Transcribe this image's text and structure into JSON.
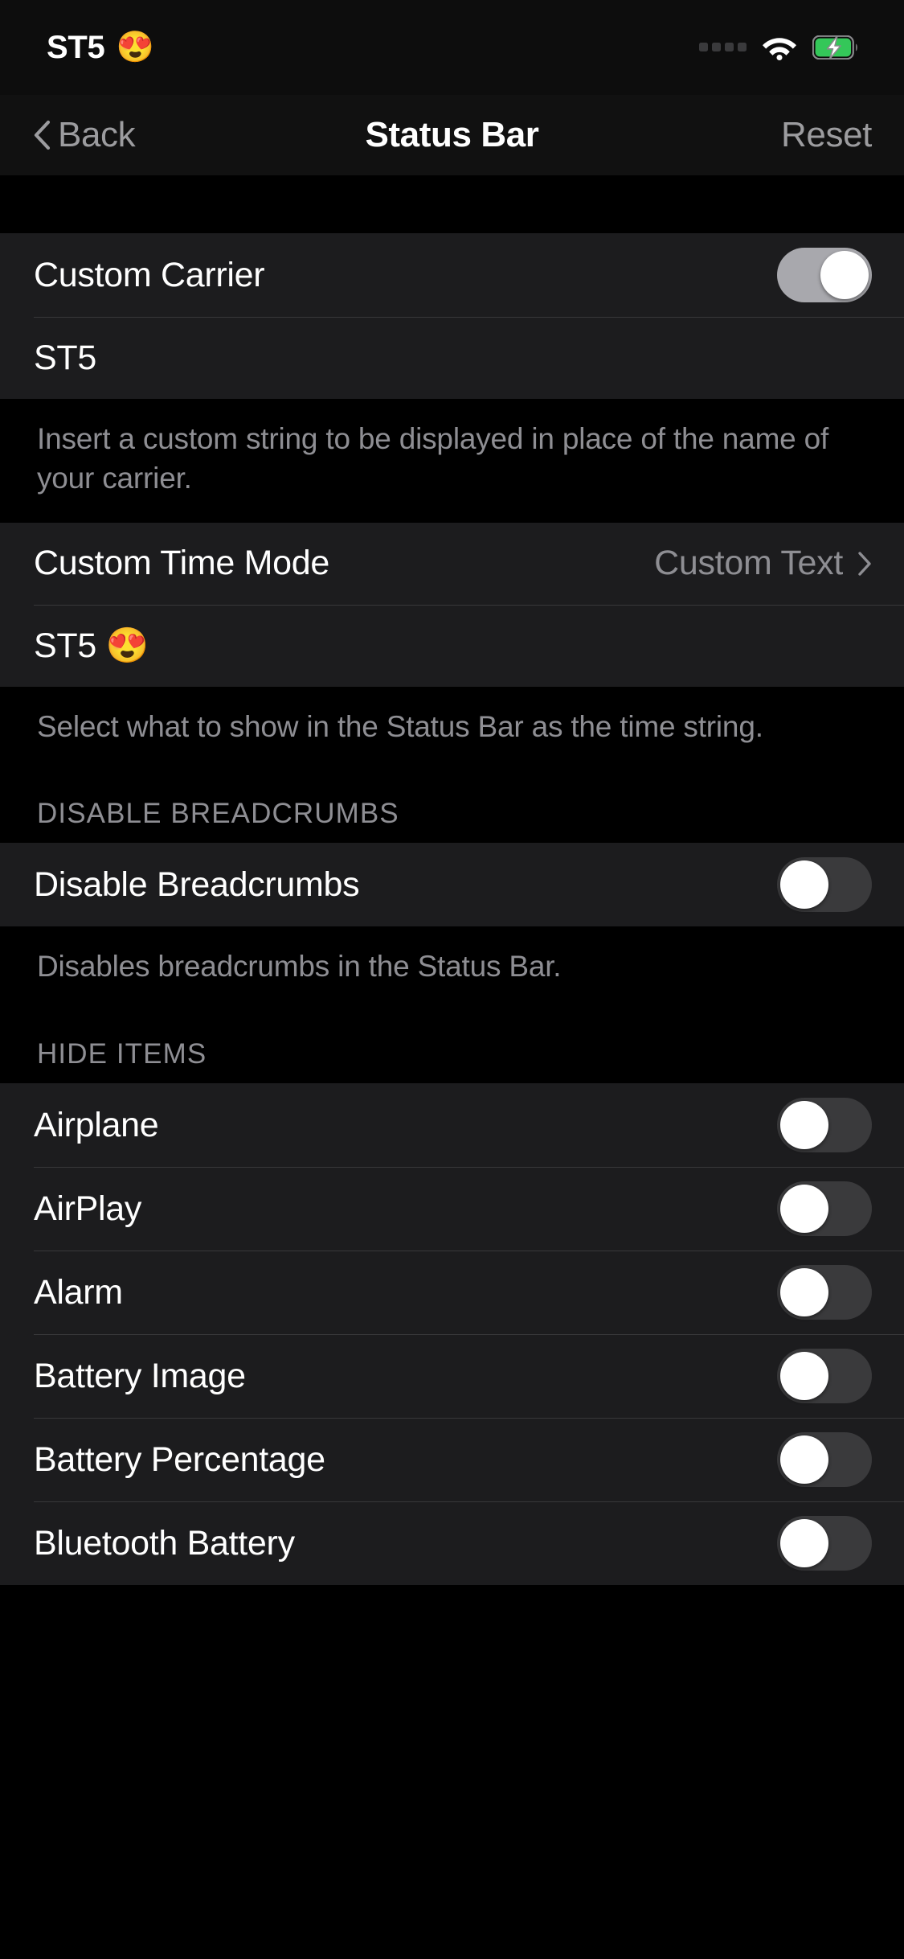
{
  "statusbar": {
    "carrier_text": "ST5",
    "carrier_emoji": "😍",
    "signal_icon": "signal-dots-icon",
    "wifi_icon": "wifi-icon",
    "battery_icon": "battery-charging-icon",
    "battery_color": "#34C759"
  },
  "navbar": {
    "back_label": "Back",
    "title": "Status Bar",
    "reset_label": "Reset"
  },
  "sections": {
    "carrier": {
      "toggle_label": "Custom Carrier",
      "toggle_state": "on",
      "field_value": "ST5",
      "field_placeholder": "ST5",
      "footer": "Insert a custom string to be displayed in place of the name of your carrier."
    },
    "time": {
      "mode_label": "Custom Time Mode",
      "mode_value": "Custom Text",
      "chevron_icon": "chevron-right-icon",
      "field_value": "ST5 😍",
      "field_placeholder": "ST5 😍",
      "footer": "Select what to show in the Status Bar as the time string."
    },
    "breadcrumbs": {
      "header": "DISABLE BREADCRUMBS",
      "toggle_label": "Disable Breadcrumbs",
      "toggle_state": "off",
      "footer": "Disables breadcrumbs in the Status Bar."
    },
    "hide_items": {
      "header": "HIDE ITEMS",
      "items": [
        {
          "label": "Airplane",
          "state": "off"
        },
        {
          "label": "AirPlay",
          "state": "off"
        },
        {
          "label": "Alarm",
          "state": "off"
        },
        {
          "label": "Battery Image",
          "state": "off"
        },
        {
          "label": "Battery Percentage",
          "state": "off"
        },
        {
          "label": "Bluetooth Battery",
          "state": "off"
        }
      ]
    }
  },
  "colors": {
    "background": "#000000",
    "cell": "#1C1C1E",
    "separator": "#38383A",
    "secondary_text": "#8E8E93",
    "toggle_off_track": "#3A3A3C",
    "toggle_on_gray_track": "#A8A8AD"
  }
}
